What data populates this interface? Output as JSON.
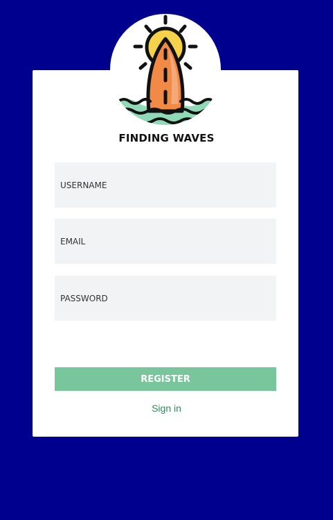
{
  "brand": {
    "title": "FINDING WAVES",
    "logo_icon": "surfboard-sun-waves-icon"
  },
  "form": {
    "username_placeholder": "USERNAME",
    "email_placeholder": "EMAIL",
    "password_placeholder": "PASSWORD",
    "register_label": "REGISTER",
    "signin_label": "Sign in"
  },
  "colors": {
    "background": "#00008f",
    "card": "#ffffff",
    "input_bg": "#f2f3f5",
    "button": "#79c59c",
    "link": "#2e8b57",
    "sun": "#f6d24a",
    "surfboard": "#f08a45",
    "water": "#8fd9b6"
  }
}
